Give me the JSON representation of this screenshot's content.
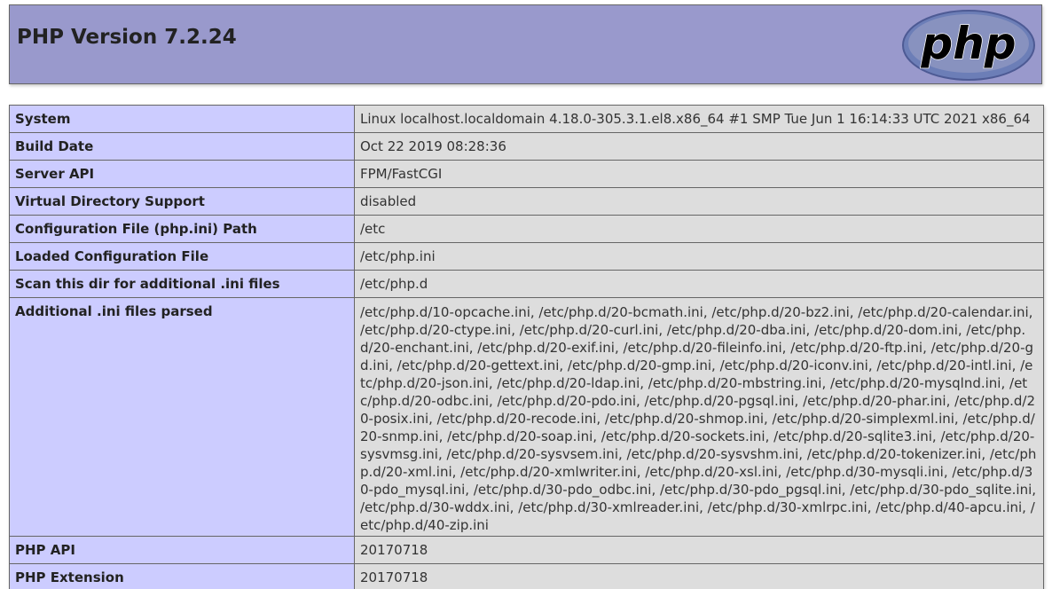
{
  "header": {
    "title": "PHP Version 7.2.24",
    "logo_text": "php"
  },
  "colors": {
    "header_bg": "#9999cc",
    "key_cell_bg": "#ccccff",
    "value_cell_bg": "#dddddd",
    "border": "#666666"
  },
  "rows": [
    {
      "key": "System",
      "value": "Linux localhost.localdomain 4.18.0-305.3.1.el8.x86_64 #1 SMP Tue Jun 1 16:14:33 UTC 2021 x86_64"
    },
    {
      "key": "Build Date",
      "value": "Oct 22 2019 08:28:36"
    },
    {
      "key": "Server API",
      "value": "FPM/FastCGI"
    },
    {
      "key": "Virtual Directory Support",
      "value": "disabled"
    },
    {
      "key": "Configuration File (php.ini) Path",
      "value": "/etc"
    },
    {
      "key": "Loaded Configuration File",
      "value": "/etc/php.ini"
    },
    {
      "key": "Scan this dir for additional .ini files",
      "value": "/etc/php.d"
    },
    {
      "key": "Additional .ini files parsed",
      "value": "/etc/php.d/10-opcache.ini, /etc/php.d/20-bcmath.ini, /etc/php.d/20-bz2.ini, /etc/php.d/20-calendar.ini, /etc/php.d/20-ctype.ini, /etc/php.d/20-curl.ini, /etc/php.d/20-dba.ini, /etc/php.d/20-dom.ini, /etc/php.d/20-enchant.ini, /etc/php.d/20-exif.ini, /etc/php.d/20-fileinfo.ini, /etc/php.d/20-ftp.ini, /etc/php.d/20-gd.ini, /etc/php.d/20-gettext.ini, /etc/php.d/20-gmp.ini, /etc/php.d/20-iconv.ini, /etc/php.d/20-intl.ini, /etc/php.d/20-json.ini, /etc/php.d/20-ldap.ini, /etc/php.d/20-mbstring.ini, /etc/php.d/20-mysqlnd.ini, /etc/php.d/20-odbc.ini, /etc/php.d/20-pdo.ini, /etc/php.d/20-pgsql.ini, /etc/php.d/20-phar.ini, /etc/php.d/20-posix.ini, /etc/php.d/20-recode.ini, /etc/php.d/20-shmop.ini, /etc/php.d/20-simplexml.ini, /etc/php.d/20-snmp.ini, /etc/php.d/20-soap.ini, /etc/php.d/20-sockets.ini, /etc/php.d/20-sqlite3.ini, /etc/php.d/20-sysvmsg.ini, /etc/php.d/20-sysvsem.ini, /etc/php.d/20-sysvshm.ini, /etc/php.d/20-tokenizer.ini, /etc/php.d/20-xml.ini, /etc/php.d/20-xmlwriter.ini, /etc/php.d/20-xsl.ini, /etc/php.d/30-mysqli.ini, /etc/php.d/30-pdo_mysql.ini, /etc/php.d/30-pdo_odbc.ini, /etc/php.d/30-pdo_pgsql.ini, /etc/php.d/30-pdo_sqlite.ini, /etc/php.d/30-wddx.ini, /etc/php.d/30-xmlreader.ini, /etc/php.d/30-xmlrpc.ini, /etc/php.d/40-apcu.ini, /etc/php.d/40-zip.ini"
    },
    {
      "key": "PHP API",
      "value": "20170718"
    },
    {
      "key": "PHP Extension",
      "value": "20170718"
    }
  ]
}
